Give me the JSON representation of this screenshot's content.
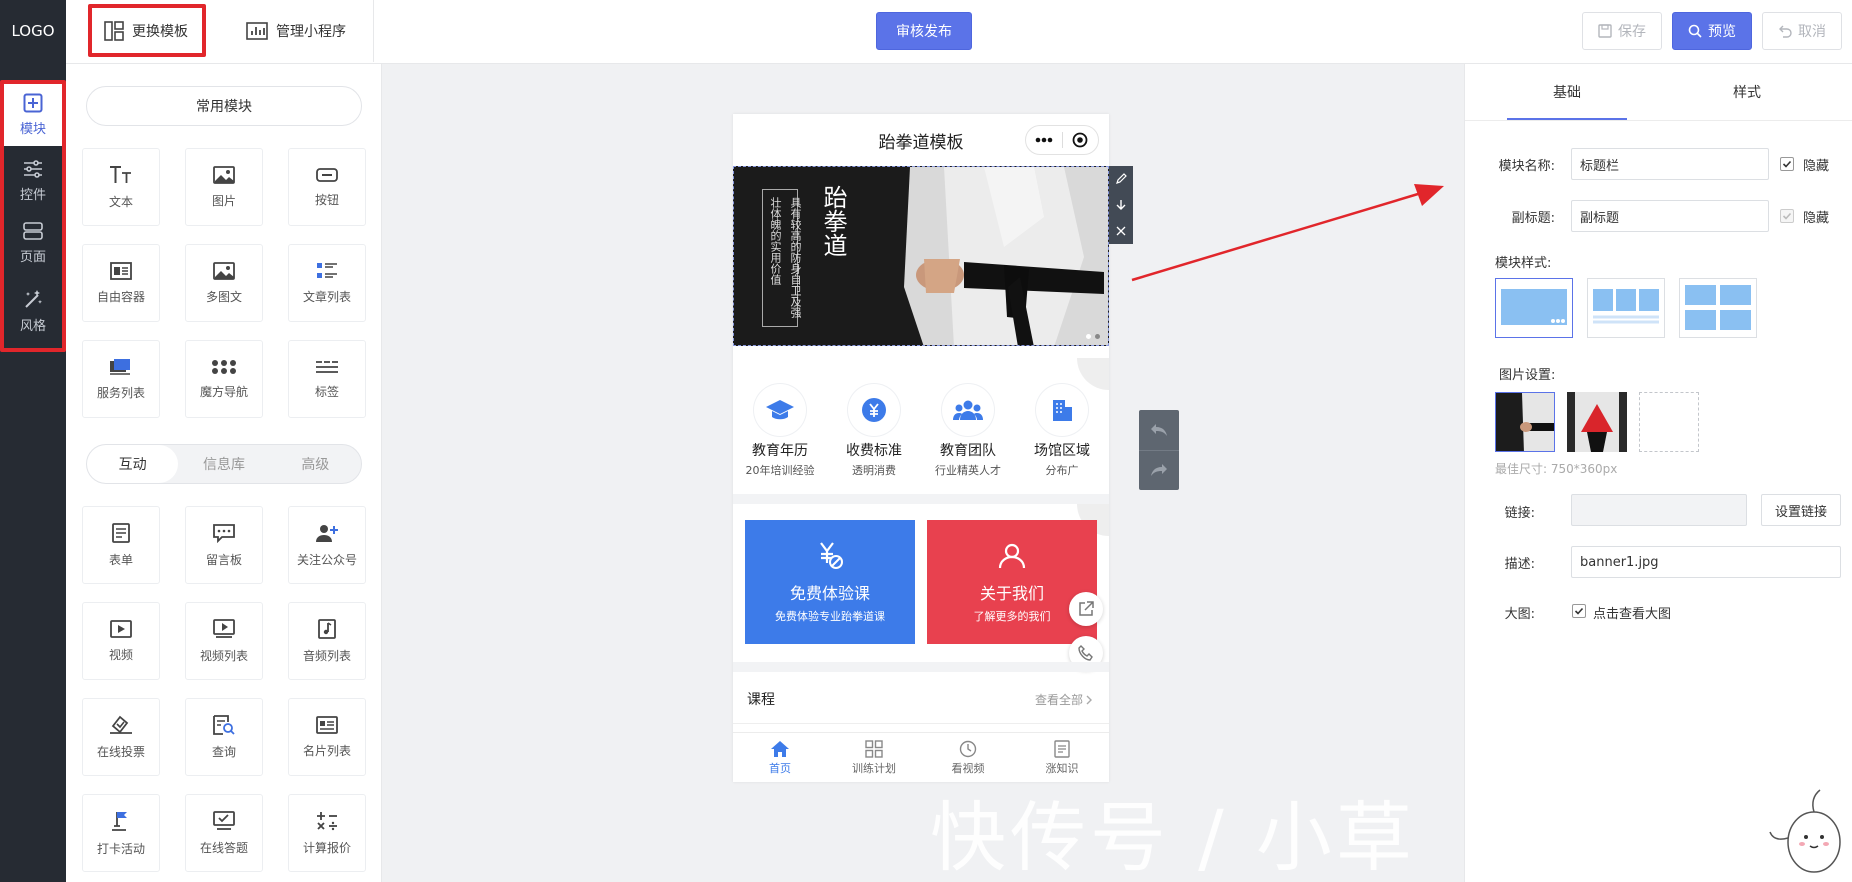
{
  "app": {
    "logo": "LOGO"
  },
  "leftnav": [
    {
      "label": "模块",
      "icon": "plus-square-icon"
    },
    {
      "label": "控件",
      "icon": "sliders-icon"
    },
    {
      "label": "页面",
      "icon": "layers-icon"
    },
    {
      "label": "风格",
      "icon": "magic-wand-icon"
    }
  ],
  "topbar": {
    "tab_template": "更换模板",
    "tab_manage": "管理小程序",
    "publish": "审核发布",
    "save": "保存",
    "preview": "预览",
    "undo": "取消"
  },
  "modules": {
    "common_label": "常用模块",
    "common": [
      {
        "label": "文本",
        "icon": "text-icon"
      },
      {
        "label": "图片",
        "icon": "image-icon"
      },
      {
        "label": "按钮",
        "icon": "button-icon"
      },
      {
        "label": "自由容器",
        "icon": "container-icon"
      },
      {
        "label": "多图文",
        "icon": "multi-image-icon"
      },
      {
        "label": "文章列表",
        "icon": "article-list-icon"
      },
      {
        "label": "服务列表",
        "icon": "service-list-icon"
      },
      {
        "label": "魔方导航",
        "icon": "grid-dots-icon"
      },
      {
        "label": "标签",
        "icon": "tag-lines-icon"
      }
    ],
    "seg_tabs": [
      "互动",
      "信息库",
      "高级"
    ],
    "interactive": [
      {
        "label": "表单",
        "icon": "form-icon"
      },
      {
        "label": "留言板",
        "icon": "message-icon"
      },
      {
        "label": "关注公众号",
        "icon": "follow-user-icon"
      },
      {
        "label": "视频",
        "icon": "video-icon"
      },
      {
        "label": "视频列表",
        "icon": "video-list-icon"
      },
      {
        "label": "音频列表",
        "icon": "audio-icon"
      },
      {
        "label": "在线投票",
        "icon": "vote-icon"
      },
      {
        "label": "查询",
        "icon": "search-doc-icon"
      },
      {
        "label": "名片列表",
        "icon": "card-icon"
      },
      {
        "label": "打卡活动",
        "icon": "flag-icon"
      },
      {
        "label": "在线答题",
        "icon": "quiz-icon"
      },
      {
        "label": "计算报价",
        "icon": "calculator-icon"
      }
    ]
  },
  "phone": {
    "title": "跆拳道模板",
    "banner": {
      "heading": "跆拳道",
      "line1": "具有较高的防身自卫及强",
      "line2": "壮体魄的实用价值"
    },
    "features": [
      {
        "title": "教育年历",
        "sub": "20年培训经验",
        "icon": "graduation-cap-icon"
      },
      {
        "title": "收费标准",
        "sub": "透明消费",
        "icon": "yen-coin-icon"
      },
      {
        "title": "教育团队",
        "sub": "行业精英人才",
        "icon": "team-icon"
      },
      {
        "title": "场馆区域",
        "sub": "分布广",
        "icon": "building-icon"
      }
    ],
    "cards": [
      {
        "title": "免费体验课",
        "sub": "免费体验专业跆拳道课",
        "color": "#3d7be9"
      },
      {
        "title": "关于我们",
        "sub": "了解更多的我们",
        "color": "#e8414f"
      }
    ],
    "course": {
      "label": "课程",
      "more": "查看全部"
    },
    "tabs": [
      "首页",
      "训练计划",
      "看视频",
      "涨知识"
    ]
  },
  "rpanel": {
    "tabs": [
      "基础",
      "样式"
    ],
    "name_label": "模块名称:",
    "name_value": "标题栏",
    "hide1": "隐藏",
    "subtitle_label": "副标题:",
    "subtitle_value": "副标题",
    "hide2": "隐藏",
    "style_label": "模块样式:",
    "image_label": "图片设置:",
    "best_size": "最佳尺寸: 750*360px",
    "link_label": "链接:",
    "link_button": "设置链接",
    "desc_label": "描述:",
    "desc_value": "banner1.jpg",
    "big_label": "大图:",
    "big_value": "点击查看大图"
  },
  "watermark": "快传号 / 小草",
  "colors": {
    "accent": "#5b73e8",
    "nav_dark": "#262b33",
    "highlight_red": "#e1262b",
    "blue_card": "#3d7be9",
    "red_card": "#e8414f"
  }
}
